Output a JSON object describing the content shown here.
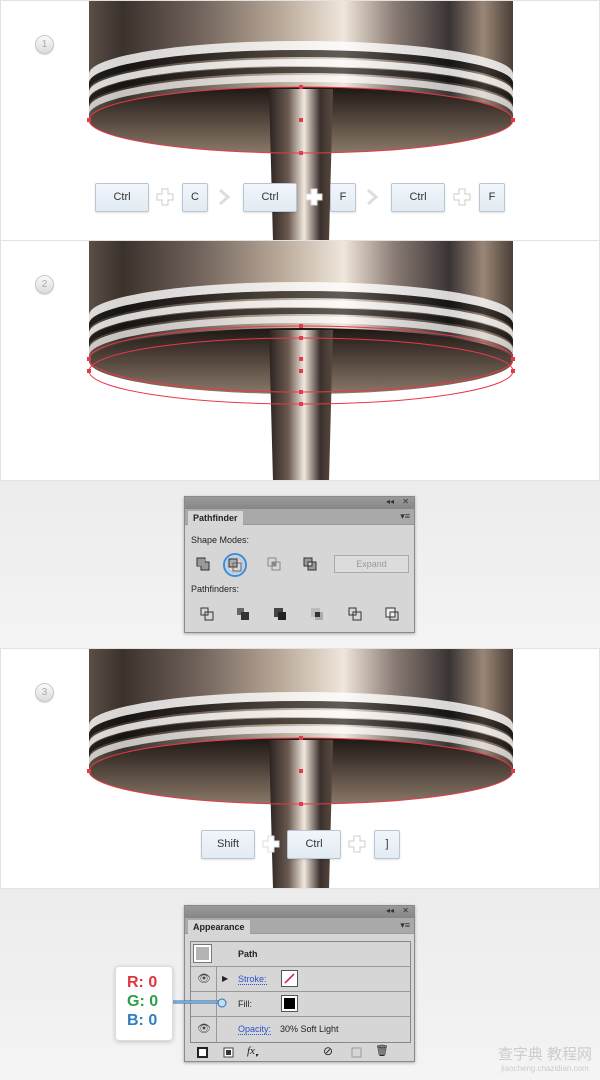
{
  "steps": [
    {
      "badge": "1",
      "keys": [
        "Ctrl",
        "C",
        "Ctrl",
        "F",
        "Ctrl",
        "F"
      ]
    },
    {
      "badge": "2"
    },
    {
      "badge": "3",
      "keys": [
        "Shift",
        "Ctrl",
        "]"
      ]
    }
  ],
  "pathfinder": {
    "tab": "Pathfinder",
    "shape_modes_label": "Shape Modes:",
    "shape_modes": [
      "unite",
      "minus-front",
      "intersect",
      "exclude"
    ],
    "selected_shape_mode": "minus-front",
    "expand_label": "Expand",
    "pathfinders_label": "Pathfinders:",
    "pathfinders": [
      "divide",
      "trim",
      "merge",
      "crop",
      "outline",
      "minus-back"
    ]
  },
  "appearance": {
    "tab": "Appearance",
    "object": "Path",
    "stroke_label": "Stroke:",
    "fill_label": "Fill:",
    "opacity_label": "Opacity:",
    "opacity_value": "30% Soft Light",
    "fill_color": "#000000"
  },
  "rgb": {
    "r": "R: 0",
    "g": "G: 0",
    "b": "B: 0",
    "r_color": "#e0343f",
    "g_color": "#2e9e4a",
    "b_color": "#2f7fc0"
  },
  "colors": {
    "path_outline": "#e8394a",
    "key_bg": "#e8eef6"
  },
  "watermark": {
    "cn": "查字典 教程网",
    "url": "jiaocheng.chazidian.com"
  }
}
